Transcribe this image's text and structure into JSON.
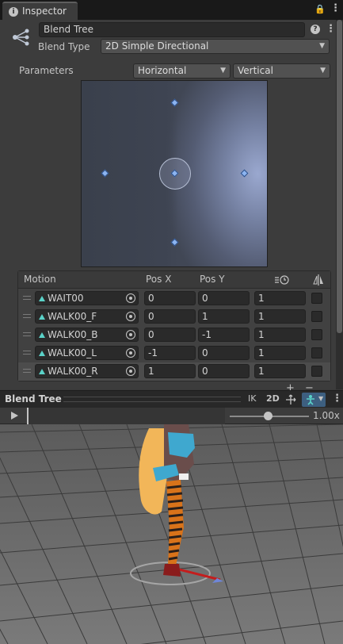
{
  "tab": {
    "title": "Inspector"
  },
  "header": {
    "name_value": "Blend Tree"
  },
  "blend_type": {
    "label": "Blend Type",
    "value": "2D Simple Directional"
  },
  "parameters": {
    "label": "Parameters",
    "x_param": "Horizontal",
    "y_param": "Vertical"
  },
  "table": {
    "headers": {
      "motion": "Motion",
      "pos_x": "Pos X",
      "pos_y": "Pos Y"
    },
    "rows": [
      {
        "motion": "WAIT00",
        "pos_x": "0",
        "pos_y": "0",
        "speed": "1"
      },
      {
        "motion": "WALK00_F",
        "pos_x": "0",
        "pos_y": "1",
        "speed": "1"
      },
      {
        "motion": "WALK00_B",
        "pos_x": "0",
        "pos_y": "-1",
        "speed": "1"
      },
      {
        "motion": "WALK00_L",
        "pos_x": "-1",
        "pos_y": "0",
        "speed": "1"
      },
      {
        "motion": "WALK00_R",
        "pos_x": "1",
        "pos_y": "0",
        "speed": "1"
      }
    ]
  },
  "preview": {
    "title": "Blend Tree",
    "ik_label": "IK",
    "mode_label": "2D",
    "speed_value": "1.00x"
  },
  "colors": {
    "accent": "#3d5f80",
    "point": "#8cb4f0"
  }
}
